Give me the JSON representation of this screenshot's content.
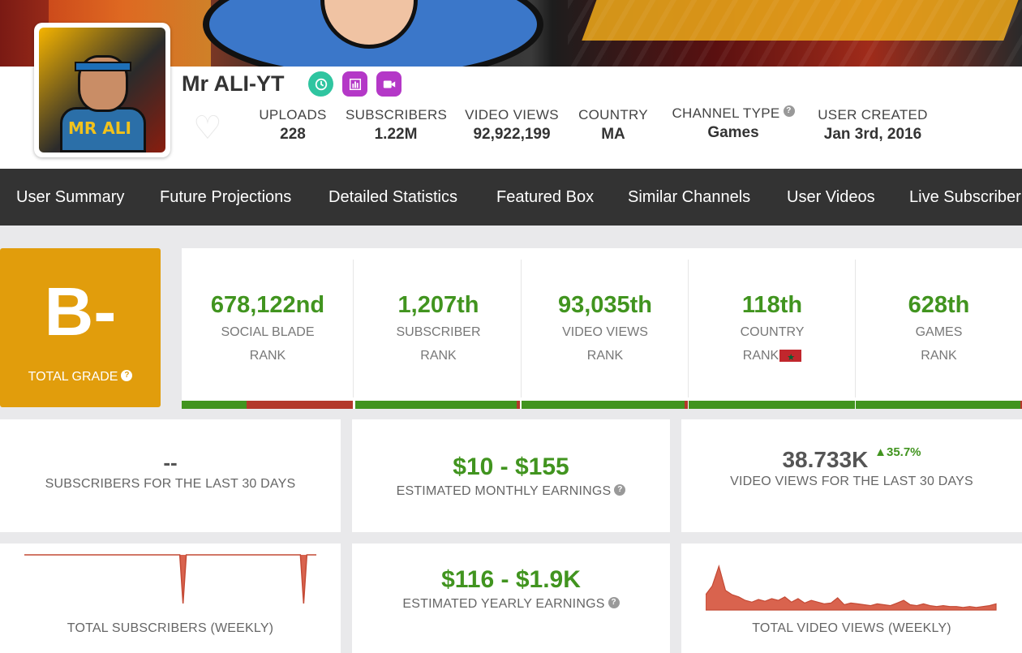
{
  "channel": {
    "name": "Mr ALI-YT",
    "avatar_text": "MR ALI",
    "stats": [
      {
        "label": "UPLOADS",
        "value": "228"
      },
      {
        "label": "SUBSCRIBERS",
        "value": "1.22M"
      },
      {
        "label": "VIDEO VIEWS",
        "value": "92,922,199"
      },
      {
        "label": "COUNTRY",
        "value": "MA"
      },
      {
        "label": "CHANNEL TYPE",
        "value": "Games"
      },
      {
        "label": "USER CREATED",
        "value": "Jan 3rd, 2016"
      }
    ]
  },
  "icons": {
    "badge1": "clock-icon",
    "badge2": "bar-chart-icon",
    "badge3": "video-camera-icon",
    "favorite": "heart-icon",
    "help": "question-icon"
  },
  "nav": [
    "User Summary",
    "Future Projections",
    "Detailed Statistics",
    "Featured Box",
    "Similar Channels",
    "User Videos",
    "Live Subscriber Count"
  ],
  "grade": {
    "letter": "B-",
    "label": "TOTAL GRADE",
    "color": "#e19d0c"
  },
  "ranks": [
    {
      "value": "678,122nd",
      "line1": "SOCIAL BLADE",
      "line2": "RANK",
      "fill": 0.38
    },
    {
      "value": "1,207th",
      "line1": "SUBSCRIBER",
      "line2": "RANK",
      "fill": 0.98
    },
    {
      "value": "93,035th",
      "line1": "VIDEO VIEWS",
      "line2": "RANK",
      "fill": 0.98
    },
    {
      "value": "118th",
      "line1": "COUNTRY",
      "line2": "RANK",
      "fill": 1.0
    },
    {
      "value": "628th",
      "line1": "GAMES",
      "line2": "RANK",
      "fill": 0.99
    }
  ],
  "cards": {
    "subs30": {
      "value": "--",
      "label": "SUBSCRIBERS FOR THE LAST 30 DAYS"
    },
    "monthly": {
      "value": "$10  -  $155",
      "label": "ESTIMATED MONTHLY EARNINGS"
    },
    "views30": {
      "value": "38.733K",
      "change": "35.7%",
      "label": "VIDEO VIEWS FOR THE LAST 30 DAYS"
    },
    "weekly_subs": {
      "label": "TOTAL SUBSCRIBERS (WEEKLY)"
    },
    "yearly": {
      "value": "$116  -  $1.9K",
      "label": "ESTIMATED YEARLY EARNINGS"
    },
    "weekly_views": {
      "label": "TOTAL VIDEO VIEWS (WEEKLY)"
    }
  },
  "colors": {
    "green": "#41941f",
    "red": "#b3382a",
    "nav_bg": "#333333",
    "spark": "#d9634e"
  },
  "sparklines": {
    "weekly_subs": [
      0,
      0,
      0,
      0,
      0,
      0,
      0,
      0,
      0,
      0,
      0,
      0,
      0,
      0,
      0,
      0,
      0,
      0,
      0,
      0,
      0,
      0,
      0,
      0,
      0,
      -1,
      0,
      0,
      0,
      0,
      0,
      0,
      0,
      0,
      0,
      0,
      0,
      0,
      0,
      0,
      0,
      0,
      0,
      0,
      -1,
      0,
      0
    ],
    "weekly_views": [
      0.35,
      0.55,
      1.0,
      0.45,
      0.35,
      0.3,
      0.22,
      0.18,
      0.24,
      0.2,
      0.26,
      0.22,
      0.3,
      0.18,
      0.26,
      0.16,
      0.22,
      0.18,
      0.14,
      0.16,
      0.28,
      0.12,
      0.16,
      0.14,
      0.12,
      0.1,
      0.14,
      0.12,
      0.1,
      0.16,
      0.22,
      0.12,
      0.1,
      0.14,
      0.1,
      0.08,
      0.1,
      0.08,
      0.08,
      0.06,
      0.08,
      0.06,
      0.08,
      0.1,
      0.14
    ]
  }
}
